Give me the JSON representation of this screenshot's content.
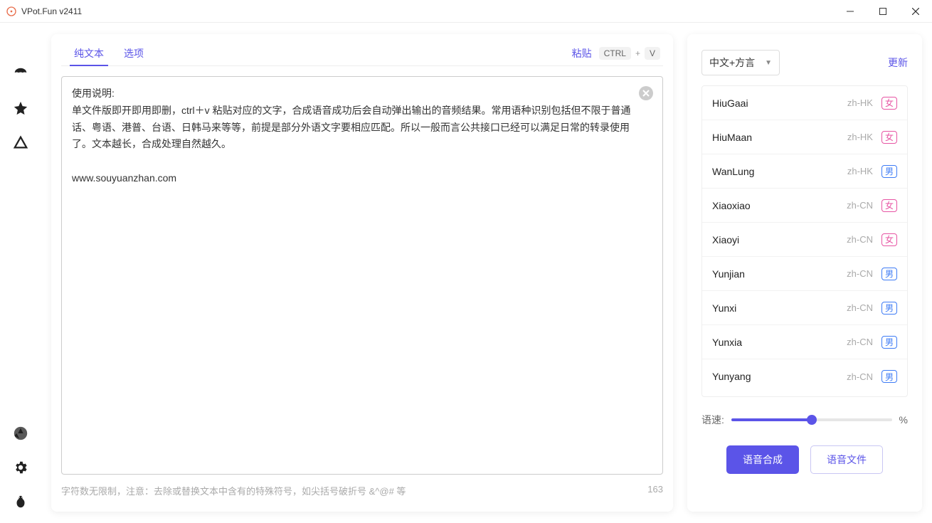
{
  "window": {
    "title": "VPot.Fun v2411"
  },
  "tabs": {
    "text": "纯文本",
    "options": "选项"
  },
  "paste": {
    "label": "粘贴",
    "key1": "CTRL",
    "plus": "+",
    "key2": "V"
  },
  "editor": {
    "content": "使用说明:\n单文件版即开即用即删，ctrl＋v 粘贴对应的文字，合成语音成功后会自动弹出输出的音频结果。常用语种识别包括但不限于普通话、粤语、港普、台语、日韩马来等等，前提是部分外语文字要相应匹配。所以一般而言公共接口已经可以满足日常的转录使用了。文本越长，合成处理自然越久。\n\nwww.souyuanzhan.com"
  },
  "footer": {
    "hint": "字符数无限制，注意：去除或替换文本中含有的特殊符号，如尖括号破折号 &^@# 等",
    "count": "163"
  },
  "right": {
    "language": "中文+方言",
    "update": "更新",
    "speed_label": "语速:",
    "percent": "%",
    "synth": "语音合成",
    "file": "语音文件"
  },
  "voices": [
    {
      "name": "HiuGaai",
      "lang": "zh-HK",
      "gender": "女"
    },
    {
      "name": "HiuMaan",
      "lang": "zh-HK",
      "gender": "女"
    },
    {
      "name": "WanLung",
      "lang": "zh-HK",
      "gender": "男"
    },
    {
      "name": "Xiaoxiao",
      "lang": "zh-CN",
      "gender": "女"
    },
    {
      "name": "Xiaoyi",
      "lang": "zh-CN",
      "gender": "女"
    },
    {
      "name": "Yunjian",
      "lang": "zh-CN",
      "gender": "男"
    },
    {
      "name": "Yunxi",
      "lang": "zh-CN",
      "gender": "男"
    },
    {
      "name": "Yunxia",
      "lang": "zh-CN",
      "gender": "男"
    },
    {
      "name": "Yunyang",
      "lang": "zh-CN",
      "gender": "男"
    }
  ]
}
